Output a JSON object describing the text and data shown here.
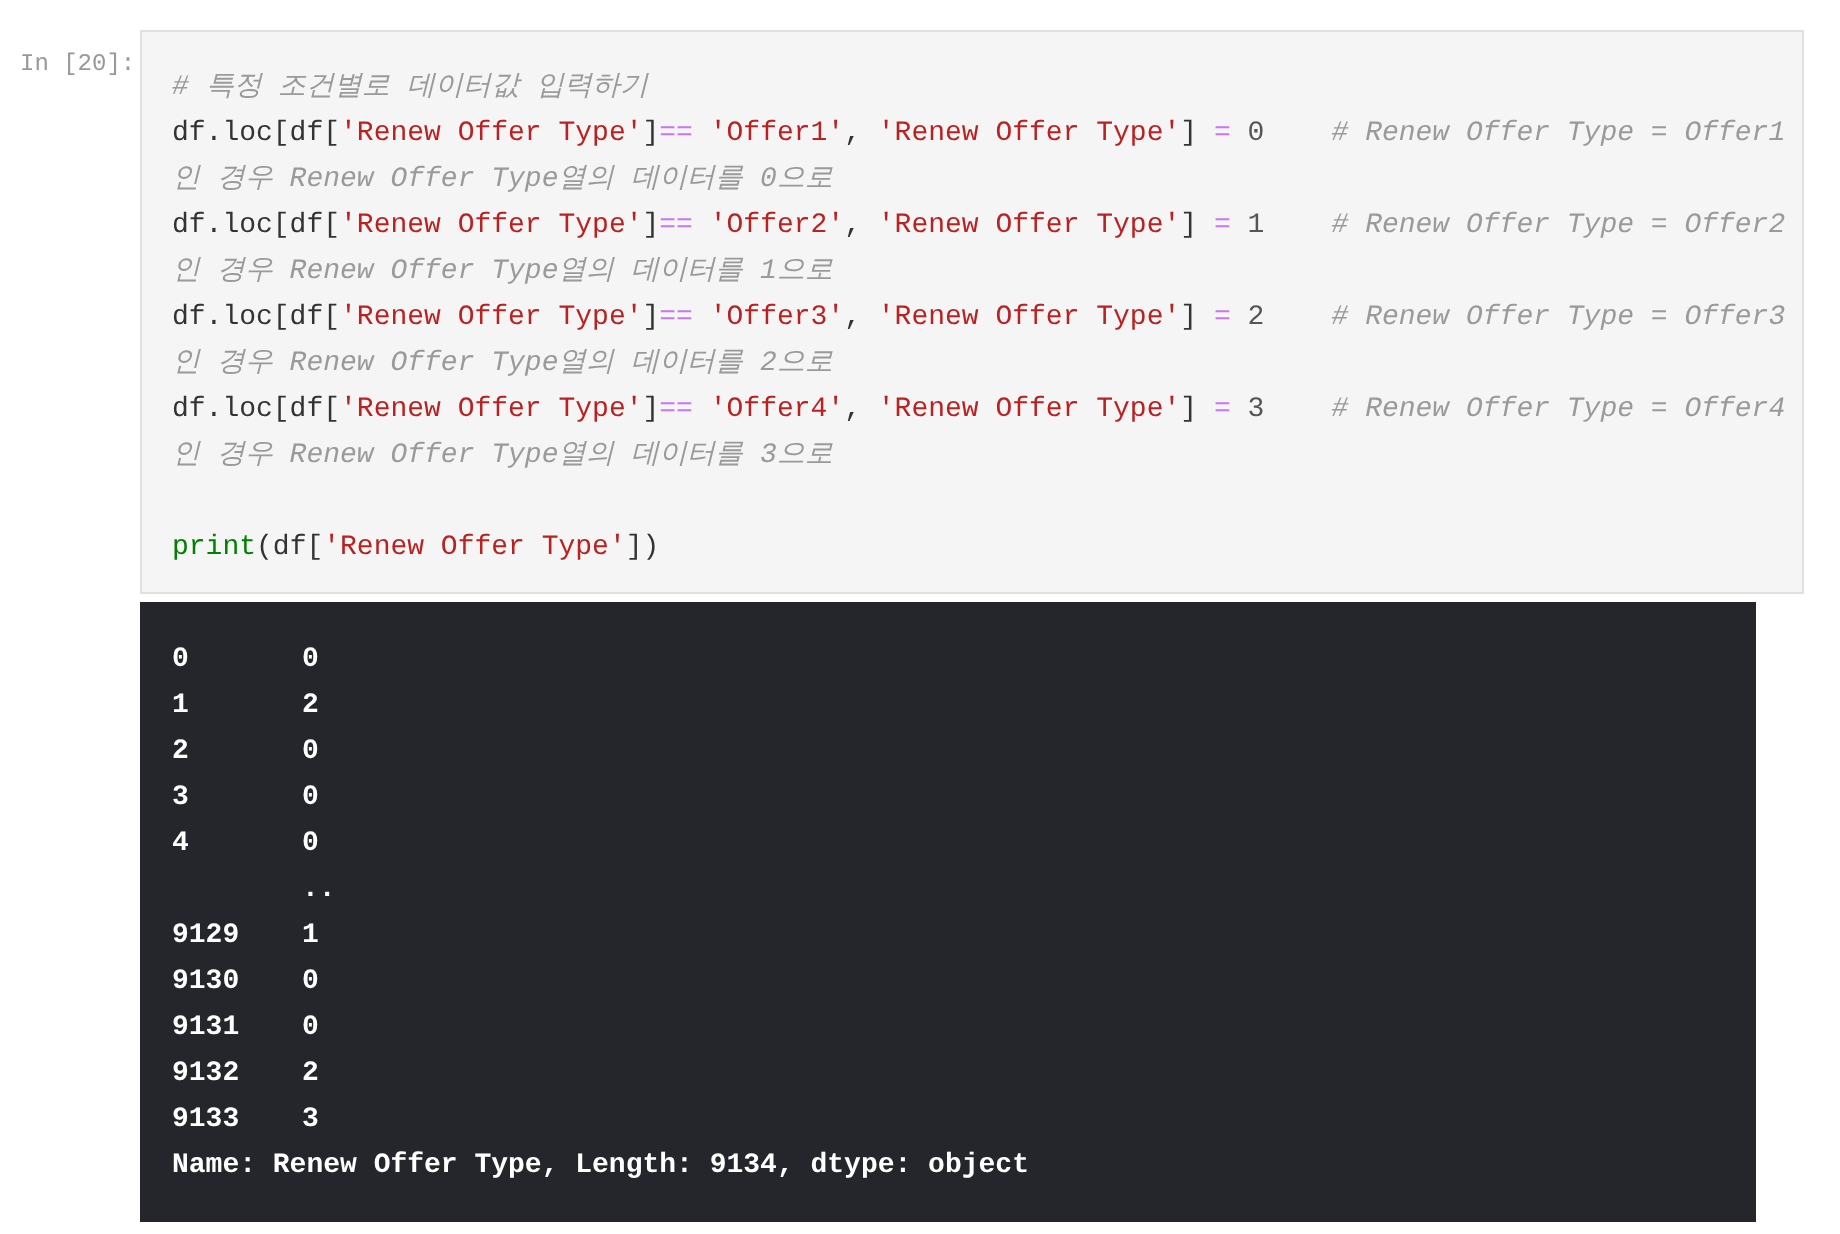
{
  "prompt": "In [20]:",
  "code_lines": [
    [
      {
        "kind": "comment",
        "text": "# 특정 조건별로 데이터값 입력하기"
      }
    ],
    [
      {
        "kind": "plain",
        "text": "df.loc[df["
      },
      {
        "kind": "string",
        "text": "'Renew Offer Type'"
      },
      {
        "kind": "plain",
        "text": "]"
      },
      {
        "kind": "op",
        "text": "=="
      },
      {
        "kind": "string",
        "text": " 'Offer1'"
      },
      {
        "kind": "plain",
        "text": ", "
      },
      {
        "kind": "string",
        "text": "'Renew Offer Type'"
      },
      {
        "kind": "plain",
        "text": "] "
      },
      {
        "kind": "op",
        "text": "="
      },
      {
        "kind": "number",
        "text": " 0"
      },
      {
        "kind": "comment",
        "text": "    # Renew Offer Type = Offer1"
      }
    ],
    [
      {
        "kind": "comment",
        "text": "인 경우 Renew Offer Type열의 데이터를 0으로"
      }
    ],
    [
      {
        "kind": "plain",
        "text": "df.loc[df["
      },
      {
        "kind": "string",
        "text": "'Renew Offer Type'"
      },
      {
        "kind": "plain",
        "text": "]"
      },
      {
        "kind": "op",
        "text": "=="
      },
      {
        "kind": "string",
        "text": " 'Offer2'"
      },
      {
        "kind": "plain",
        "text": ", "
      },
      {
        "kind": "string",
        "text": "'Renew Offer Type'"
      },
      {
        "kind": "plain",
        "text": "] "
      },
      {
        "kind": "op",
        "text": "="
      },
      {
        "kind": "number",
        "text": " 1"
      },
      {
        "kind": "comment",
        "text": "    # Renew Offer Type = Offer2"
      }
    ],
    [
      {
        "kind": "comment",
        "text": "인 경우 Renew Offer Type열의 데이터를 1으로"
      }
    ],
    [
      {
        "kind": "plain",
        "text": "df.loc[df["
      },
      {
        "kind": "string",
        "text": "'Renew Offer Type'"
      },
      {
        "kind": "plain",
        "text": "]"
      },
      {
        "kind": "op",
        "text": "=="
      },
      {
        "kind": "string",
        "text": " 'Offer3'"
      },
      {
        "kind": "plain",
        "text": ", "
      },
      {
        "kind": "string",
        "text": "'Renew Offer Type'"
      },
      {
        "kind": "plain",
        "text": "] "
      },
      {
        "kind": "op",
        "text": "="
      },
      {
        "kind": "number",
        "text": " 2"
      },
      {
        "kind": "comment",
        "text": "    # Renew Offer Type = Offer3"
      }
    ],
    [
      {
        "kind": "comment",
        "text": "인 경우 Renew Offer Type열의 데이터를 2으로"
      }
    ],
    [
      {
        "kind": "plain",
        "text": "df.loc[df["
      },
      {
        "kind": "string",
        "text": "'Renew Offer Type'"
      },
      {
        "kind": "plain",
        "text": "]"
      },
      {
        "kind": "op",
        "text": "=="
      },
      {
        "kind": "string",
        "text": " 'Offer4'"
      },
      {
        "kind": "plain",
        "text": ", "
      },
      {
        "kind": "string",
        "text": "'Renew Offer Type'"
      },
      {
        "kind": "plain",
        "text": "] "
      },
      {
        "kind": "op",
        "text": "="
      },
      {
        "kind": "number",
        "text": " 3"
      },
      {
        "kind": "comment",
        "text": "    # Renew Offer Type = Offer4"
      }
    ],
    [
      {
        "kind": "comment",
        "text": "인 경우 Renew Offer Type열의 데이터를 3으로"
      }
    ],
    {
      "blank_before": true,
      "tokens": [
        {
          "kind": "builtin",
          "text": "print"
        },
        {
          "kind": "plain",
          "text": "(df["
        },
        {
          "kind": "string",
          "text": "'Renew Offer Type'"
        },
        {
          "kind": "plain",
          "text": "])"
        }
      ]
    }
  ],
  "output": {
    "rows": [
      {
        "index": "0",
        "value": "0"
      },
      {
        "index": "1",
        "value": "2"
      },
      {
        "index": "2",
        "value": "0"
      },
      {
        "index": "3",
        "value": "0"
      },
      {
        "index": "4",
        "value": "0"
      },
      {
        "value": ".."
      },
      {
        "index": "9129",
        "value": "1"
      },
      {
        "index": "9130",
        "value": "0"
      },
      {
        "index": "9131",
        "value": "0"
      },
      {
        "index": "9132",
        "value": "2"
      },
      {
        "index": "9133",
        "value": "3"
      }
    ],
    "footer": "Name: Renew Offer Type, Length: 9134, dtype: object"
  }
}
